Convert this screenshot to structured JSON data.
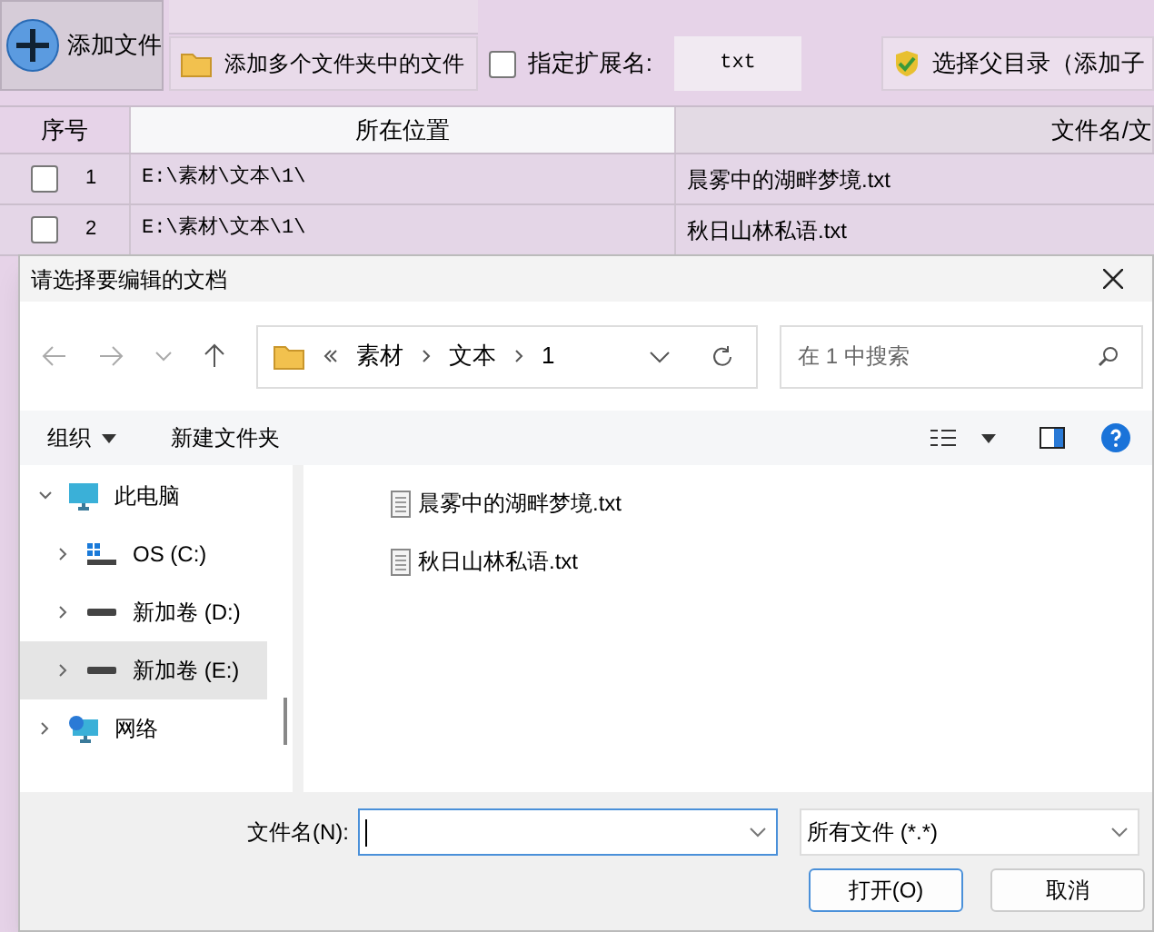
{
  "app": {
    "add_file_button": "添加文件",
    "add_folders_button": "添加多个文件夹中的文件",
    "extension_checkbox": {
      "label": "指定扩展名:",
      "checked": false
    },
    "extension_value": "txt",
    "parent_dir_button": "选择父目录（添加子"
  },
  "table": {
    "columns": [
      "序号",
      "所在位置",
      "文件名/文"
    ],
    "rows": [
      {
        "checked": false,
        "index": "1",
        "location": "E:\\素材\\文本\\1\\",
        "filename": "晨雾中的湖畔梦境.txt"
      },
      {
        "checked": false,
        "index": "2",
        "location": "E:\\素材\\文本\\1\\",
        "filename": "秋日山林私语.txt"
      }
    ]
  },
  "dialog": {
    "title": "请选择要编辑的文档",
    "breadcrumb": [
      "素材",
      "文本",
      "1"
    ],
    "search": {
      "placeholder": "在 1 中搜索"
    },
    "toolbar": [
      {
        "label": "组织",
        "dropdown": true
      },
      {
        "label": "新建文件夹",
        "dropdown": false
      }
    ],
    "tree": [
      {
        "label": "此电脑",
        "kind": "pc",
        "expanded": true,
        "selected": false,
        "children": [
          {
            "label": "OS (C:)",
            "kind": "os-drive",
            "expanded": false,
            "selected": false
          },
          {
            "label": "新加卷 (D:)",
            "kind": "drive",
            "expanded": false,
            "selected": false
          },
          {
            "label": "新加卷 (E:)",
            "kind": "drive",
            "expanded": false,
            "selected": true
          }
        ]
      },
      {
        "label": "网络",
        "kind": "network",
        "expanded": false,
        "selected": false
      }
    ],
    "files": [
      "晨雾中的湖畔梦境.txt",
      "秋日山林私语.txt"
    ],
    "filename_label": "文件名(N):",
    "file_type": "所有文件 (*.*)",
    "buttons": [
      {
        "label": "打开(O)",
        "default": true
      },
      {
        "label": "取消",
        "default": false
      }
    ]
  }
}
